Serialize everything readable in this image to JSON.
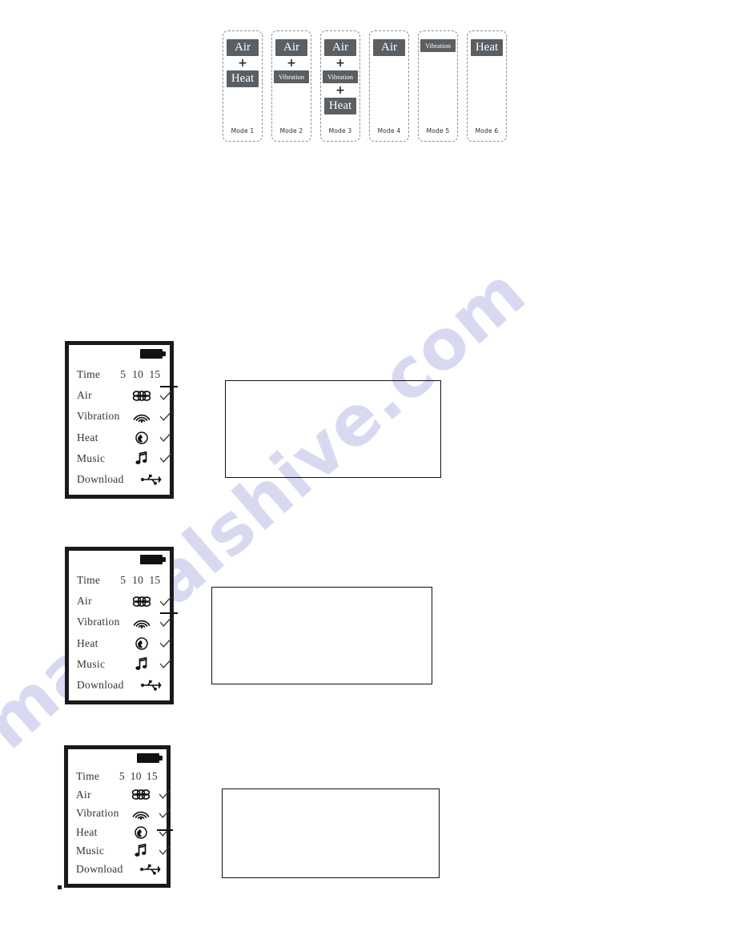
{
  "page": {
    "watermark": "manualshive.com"
  },
  "modes": {
    "cards": [
      {
        "label": "Mode 1",
        "chips": [
          {
            "text": "Air",
            "size": "lg"
          },
          {
            "text": "+",
            "size": "plus"
          },
          {
            "text": "Heat",
            "size": "lg"
          }
        ]
      },
      {
        "label": "Mode 2",
        "chips": [
          {
            "text": "Air",
            "size": "lg"
          },
          {
            "text": "+",
            "size": "plus"
          },
          {
            "text": "Vibration",
            "size": "sm"
          }
        ]
      },
      {
        "label": "Mode 3",
        "chips": [
          {
            "text": "Air",
            "size": "lg"
          },
          {
            "text": "+",
            "size": "plus"
          },
          {
            "text": "Vibration",
            "size": "sm"
          },
          {
            "text": "+",
            "size": "plus"
          },
          {
            "text": "Heat",
            "size": "lg"
          }
        ]
      },
      {
        "label": "Mode 4",
        "chips": [
          {
            "text": "Air",
            "size": "lg"
          }
        ]
      },
      {
        "label": "Mode 5",
        "chips": [
          {
            "text": "Vibration",
            "size": "sm"
          }
        ]
      },
      {
        "label": "Mode 6",
        "chips": [
          {
            "text": "Heat",
            "size": "lg"
          }
        ]
      }
    ]
  },
  "lcd_common": {
    "time_label": "Time",
    "time_values": [
      "5",
      "10",
      "15"
    ],
    "rows": [
      {
        "label": "Air",
        "icon": "air-icon",
        "check": "✓"
      },
      {
        "label": "Vibration",
        "icon": "vibration-icon",
        "check": "✓"
      },
      {
        "label": "Heat",
        "icon": "heat-icon",
        "check": "✓"
      },
      {
        "label": "Music",
        "icon": "music-icon",
        "check": "✓"
      },
      {
        "label": "Download",
        "icon": "usb-icon",
        "check": ""
      }
    ],
    "battery_icon": "battery-full-icon"
  },
  "panels": [
    {
      "id": "panel-1",
      "highlight_row": "Air",
      "caption": ""
    },
    {
      "id": "panel-2",
      "highlight_row": "Vibration",
      "caption": ""
    },
    {
      "id": "panel-3",
      "highlight_row": "Heat",
      "caption": ""
    }
  ],
  "colors": {
    "chip_fill": "#5a5f63",
    "ink": "#1a1a1a",
    "text": "#333333",
    "watermark": "#b9bbe6"
  }
}
